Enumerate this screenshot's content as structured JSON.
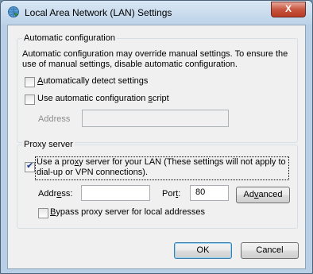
{
  "window": {
    "title": "Local Area Network (LAN) Settings",
    "close_label": "X"
  },
  "auto_config": {
    "group_label": "Automatic configuration",
    "description_line1": "Automatic configuration may override manual settings.  To ensure the",
    "description_line2": "use of manual settings, disable automatic configuration.",
    "detect": {
      "prefix": "",
      "accel": "A",
      "rest": "utomatically detect settings",
      "checked": false
    },
    "script": {
      "prefix": "Use automatic configuration ",
      "accel": "s",
      "rest": "cript",
      "checked": false
    },
    "address_label": "Address",
    "address_value": ""
  },
  "proxy": {
    "group_label": "Proxy server",
    "use_proxy": {
      "prefix": "Use a pro",
      "accel": "x",
      "rest": "y server for your LAN (These settings will not apply to",
      "line2": "dial-up or VPN connections).",
      "checked": true
    },
    "address_prefix": "Addr",
    "address_accel": "e",
    "address_rest": "ss:",
    "address_value": "",
    "port_prefix": "Por",
    "port_accel": "t",
    "port_rest": ":",
    "port_value": "80",
    "advanced_prefix": "Ad",
    "advanced_accel": "v",
    "advanced_rest": "anced",
    "bypass": {
      "prefix": "",
      "accel": "B",
      "rest": "ypass proxy server for local addresses",
      "checked": false
    }
  },
  "buttons": {
    "ok": "OK",
    "cancel": "Cancel"
  }
}
